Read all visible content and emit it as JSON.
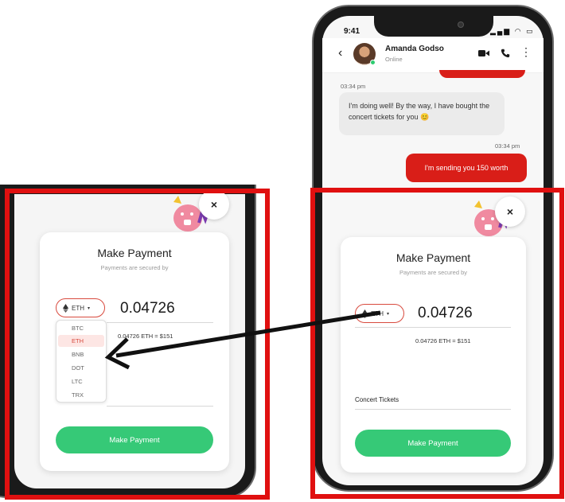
{
  "status_bar": {
    "time": "9:41",
    "icons": "▂▄▆ ◠ ▭"
  },
  "chat": {
    "contact_name": "Amanda Godso",
    "contact_status": "Online",
    "messages": [
      {
        "time": "03:34 pm",
        "text": "I'm doing well! By the way, I have bought the concert tickets for you 😊",
        "direction": "incoming"
      },
      {
        "time": "03:34 pm",
        "text": "I'm sending you 150 worth",
        "direction": "outgoing"
      }
    ]
  },
  "payment_modal": {
    "title": "Make Payment",
    "subtitle": "Payments are secured by",
    "close_label": "×",
    "selected_coin": "ETH",
    "amount": "0.04726",
    "conversion": "0.04726 ETH = $151",
    "description": "Concert Tickets",
    "pay_button": "Make Payment"
  },
  "coin_dropdown": {
    "options": [
      "BTC",
      "ETH",
      "BNB",
      "DOT",
      "LTC",
      "TRX"
    ],
    "selected": "ETH"
  },
  "colors": {
    "frame_red": "#e01010",
    "bubble_red": "#d91e18",
    "pay_green": "#36c977",
    "select_border": "#d84a3e"
  },
  "icons": [
    "back-icon",
    "video-icon",
    "phone-call-icon",
    "menu-dots-icon",
    "close-icon",
    "eth-icon",
    "chevron-down-icon",
    "arrow-annotation"
  ]
}
